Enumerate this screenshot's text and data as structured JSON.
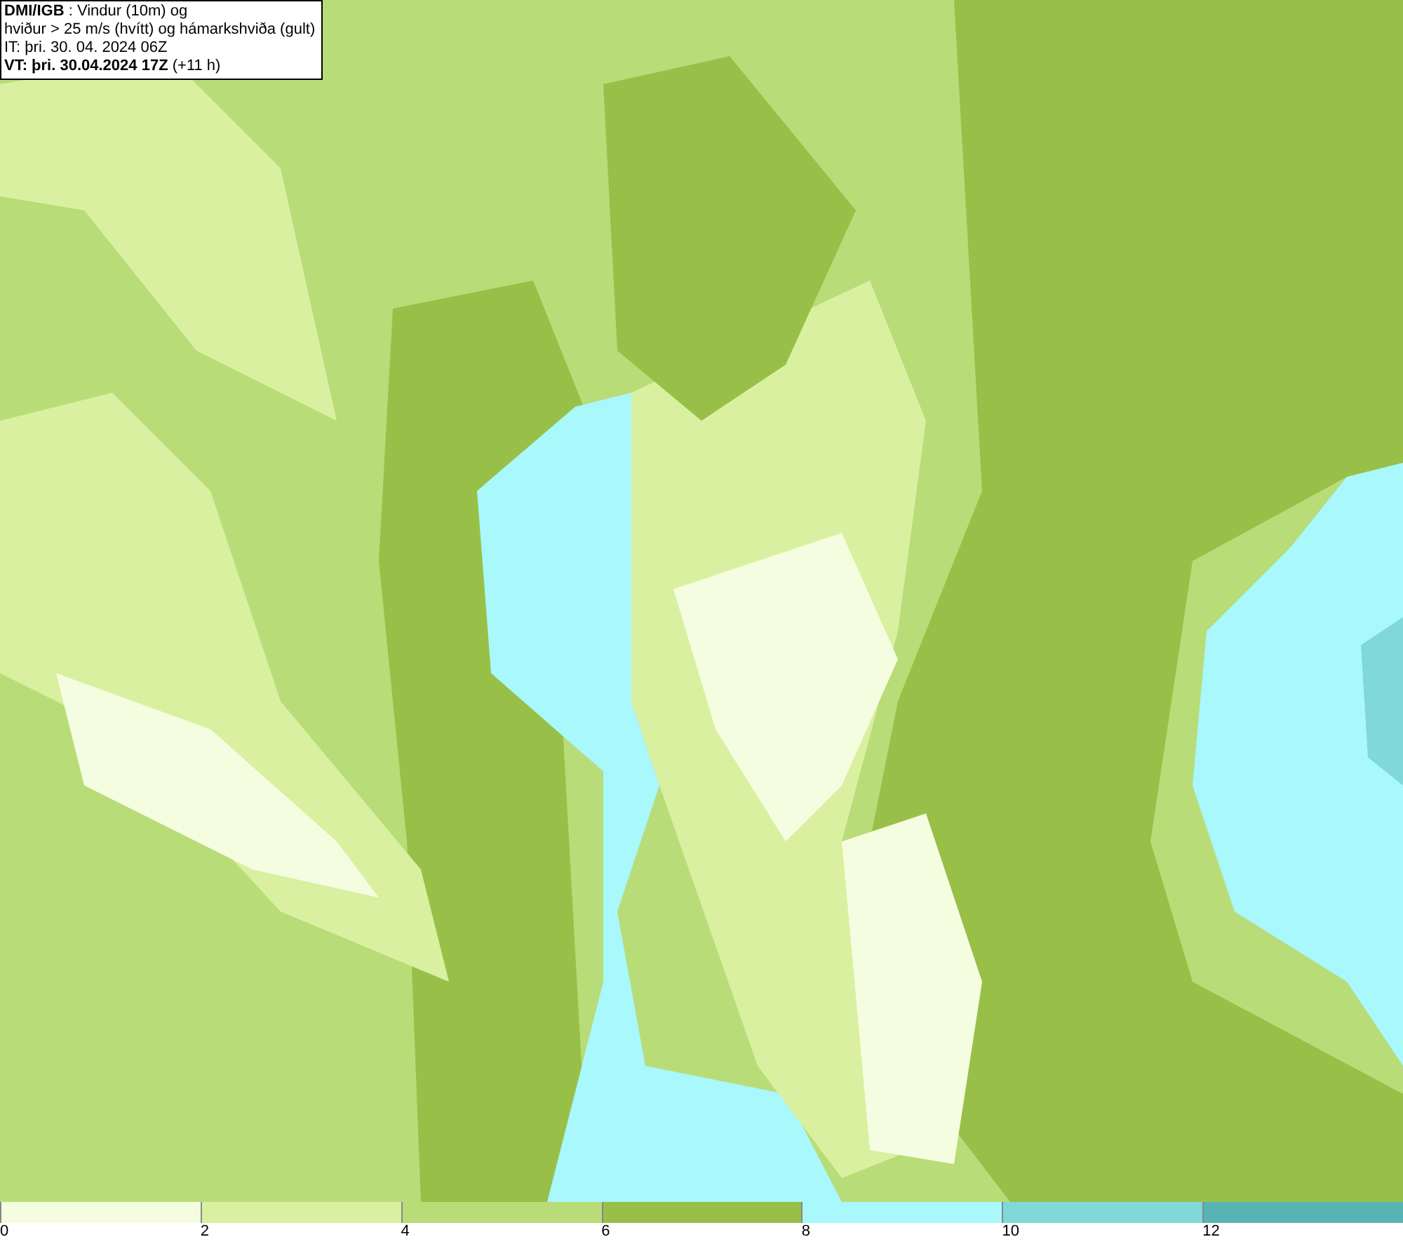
{
  "map": {
    "title_lines": [
      "**DMI/IGB** : Vindur (10m) og",
      "hviður > 25 m/s (hvítt) og hámarkshviða (gult)",
      "IT: þri. 30. 04. 2024 06Z",
      "**VT: þri. 30.04.2024 17Z** (+11 h)"
    ]
  },
  "legend": {
    "bins": [
      {
        "label": "0",
        "color": "#f5fde0"
      },
      {
        "label": "2",
        "color": "#d8f0a0"
      },
      {
        "label": "4",
        "color": "#b8dc78"
      },
      {
        "label": "6",
        "color": "#98c048"
      },
      {
        "label": "8",
        "color": "#a8f8fc"
      },
      {
        "label": "10",
        "color": "#80d8d8"
      },
      {
        "label": "12",
        "color": "#58b4b4"
      }
    ]
  }
}
